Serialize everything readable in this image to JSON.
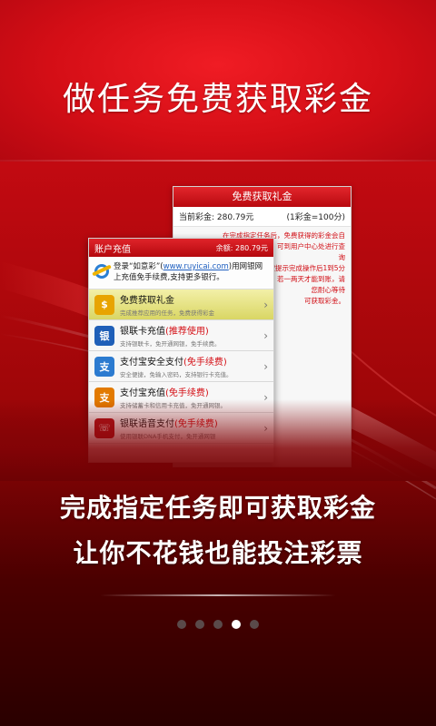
{
  "headline": "做任务免费获取彩金",
  "back_card": {
    "title": "免费获取礼金",
    "balance_label": "当前彩金: 280.79元",
    "rate": "(1彩金=100分)",
    "notes": [
      "在完成指定任务后，免费获得的彩金会自",
      "动添加到您的账户，可到用户中心处进行查",
      "询",
      "请按提示完成操作后1到5分",
      "钟到账，若一两天才能到账，请",
      "您耐心等待",
      "可获取彩金。"
    ]
  },
  "front_card": {
    "header_title": "账户充值",
    "balance": "余额: 280.79元",
    "login": {
      "prefix": "登录“如意彩”(",
      "link": "www.ruyicai.com",
      "suffix": ")用网银网上充值免手续费,支持更多银行。"
    },
    "items": [
      {
        "title": "免费获取礼金",
        "title_red": "",
        "sub": "完成推荐应用的任务，免费获得彩金",
        "icon_name": "dollar-coin-icon",
        "glyph": "$",
        "color": "#e8a400",
        "highlight": true
      },
      {
        "title": "银联卡充值",
        "title_red": "(推荐使用)",
        "sub": "支持银联卡，免开通网银，免手续费。",
        "icon_name": "unionpay-icon",
        "glyph": "银",
        "color": "#1f5fb8",
        "highlight": false
      },
      {
        "title": "支付宝安全支付",
        "title_red": "(免手续费)",
        "sub": "安全便捷，免输入密码，支持银行卡充值。",
        "icon_name": "alipay-icon",
        "glyph": "支",
        "color": "#2c7bd0",
        "highlight": false
      },
      {
        "title": "支付宝充值",
        "title_red": "(免手续费)",
        "sub": "支持储蓄卡和信用卡充值，免开通网银。",
        "icon_name": "alipay-recharge-icon",
        "glyph": "支",
        "color": "#e27a00",
        "highlight": false
      },
      {
        "title": "银联语音支付",
        "title_red": "(免手续费)",
        "sub": "使用银联DNA手机支付，免开通网银",
        "icon_name": "voice-pay-icon",
        "glyph": "☏",
        "color": "#b0151b",
        "highlight": false
      }
    ]
  },
  "slogan": {
    "line1": "完成指定任务即可获取彩金",
    "line2": "让你不花钱也能投注彩票"
  },
  "pager": {
    "count": 5,
    "active": 4
  }
}
